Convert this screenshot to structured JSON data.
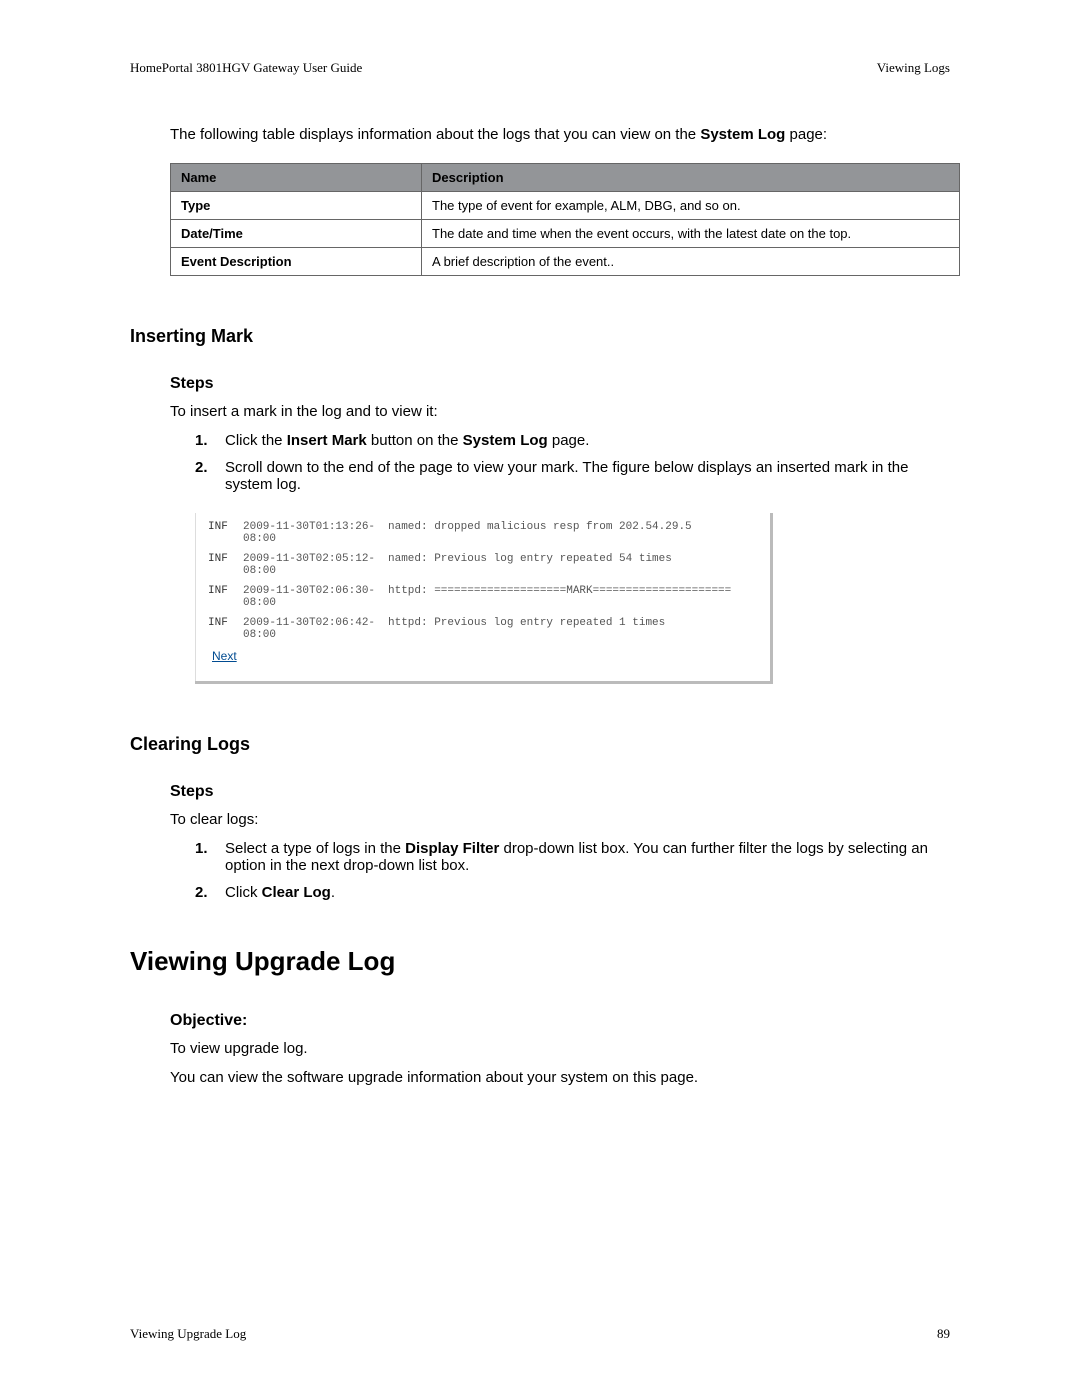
{
  "header": {
    "left": "HomePortal 3801HGV Gateway User Guide",
    "right": "Viewing Logs"
  },
  "intro_prefix": "The following table displays information about the logs that you can view on the ",
  "intro_bold": "System Log",
  "intro_suffix": " page:",
  "table": {
    "head_name": "Name",
    "head_desc": "Description",
    "rows": [
      {
        "name": "Type",
        "desc": "The type of event for example, ALM, DBG, and so on."
      },
      {
        "name": "Date/Time",
        "desc": "The date and time when the event occurs, with the latest date on the top."
      },
      {
        "name": "Event Description",
        "desc": "A brief description of the event.."
      }
    ]
  },
  "insert": {
    "title": "Inserting Mark",
    "steps_title": "Steps",
    "intro": "To insert a mark in the log and to view it:",
    "step1_num": "1.",
    "step1_a": "Click the ",
    "step1_b": "Insert Mark",
    "step1_c": " button on the ",
    "step1_d": "System Log",
    "step1_e": " page.",
    "step2_num": "2.",
    "step2": "Scroll down to the end of the page to view your mark. The figure below displays an inserted mark in the system log."
  },
  "log_entries": [
    {
      "lvl": "INF",
      "ts": "2009-11-30T01:13:26-08:00",
      "msg": "named: dropped malicious resp from 202.54.29.5"
    },
    {
      "lvl": "INF",
      "ts": "2009-11-30T02:05:12-08:00",
      "msg": "named: Previous log entry repeated 54 times"
    },
    {
      "lvl": "INF",
      "ts": "2009-11-30T02:06:30-08:00",
      "msg": "httpd: ====================MARK====================="
    },
    {
      "lvl": "INF",
      "ts": "2009-11-30T02:06:42-08:00",
      "msg": "httpd: Previous log entry repeated 1 times"
    }
  ],
  "next_label": "Next",
  "clearing": {
    "title": "Clearing Logs",
    "steps_title": "Steps",
    "intro": "To clear logs:",
    "step1_num": "1.",
    "step1_a": "Select a type of logs in the ",
    "step1_b": "Display Filter",
    "step1_c": " drop-down list box. You can further filter the logs by selecting an option in the next drop-down list box.",
    "step2_num": "2.",
    "step2_a": "Click ",
    "step2_b": "Clear Log",
    "step2_c": "."
  },
  "upgrade": {
    "title": "Viewing Upgrade Log",
    "obj_title": "Objective:",
    "obj_text": "To view upgrade log.",
    "desc": "You can view the software upgrade information about your system on this page."
  },
  "footer": {
    "left": "Viewing Upgrade Log",
    "right": "89"
  }
}
